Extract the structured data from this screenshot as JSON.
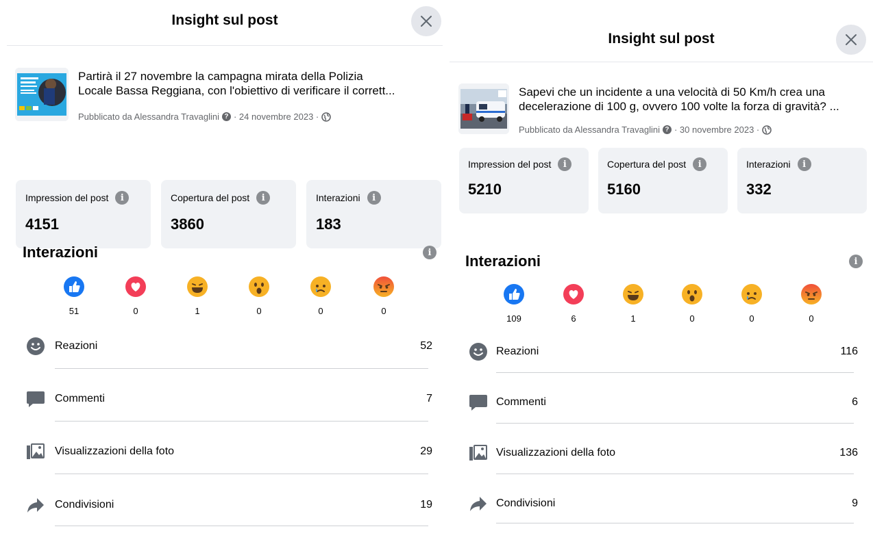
{
  "panels": [
    {
      "header_title": "Insight sul post",
      "post": {
        "text_line1": "Partirà il 27 novembre la campagna mirata della Polizia",
        "text_line2": "Locale Bassa Reggiana, con l'obiettivo di verificare il corrett...",
        "published_by": "Pubblicato da Alessandra Travaglini",
        "date": "· 24 novembre 2023 ·"
      },
      "metrics": [
        {
          "label": "Impression del post",
          "value": "4151"
        },
        {
          "label": "Copertura del post",
          "value": "3860"
        },
        {
          "label": "Interazioni",
          "value": "183"
        }
      ],
      "section_title": "Interazioni",
      "reactions": [
        {
          "icon": "like-icon",
          "count": "51"
        },
        {
          "icon": "love-icon",
          "count": "0"
        },
        {
          "icon": "haha-icon",
          "count": "1"
        },
        {
          "icon": "wow-icon",
          "count": "0"
        },
        {
          "icon": "sad-icon",
          "count": "0"
        },
        {
          "icon": "angry-icon",
          "count": "0"
        }
      ],
      "rows": [
        {
          "icon": "smiley-icon",
          "label": "Reazioni",
          "value": "52"
        },
        {
          "icon": "comment-icon",
          "label": "Commenti",
          "value": "7"
        },
        {
          "icon": "photo-icon",
          "label": "Visualizzazioni della foto",
          "value": "29"
        },
        {
          "icon": "share-icon",
          "label": "Condivisioni",
          "value": "19"
        }
      ]
    },
    {
      "header_title": "Insight sul post",
      "post": {
        "text_line1": "Sapevi che un incidente a una velocità di 50 Km/h crea una",
        "text_line2": "decelerazione di 100 g, ovvero 100 volte la forza di gravità? ...",
        "published_by": "Pubblicato da Alessandra Travaglini",
        "date": "· 30 novembre 2023 ·"
      },
      "metrics": [
        {
          "label": "Impression del post",
          "value": "5210"
        },
        {
          "label": "Copertura del post",
          "value": "5160"
        },
        {
          "label": "Interazioni",
          "value": "332"
        }
      ],
      "section_title": "Interazioni",
      "reactions": [
        {
          "icon": "like-icon",
          "count": "109"
        },
        {
          "icon": "love-icon",
          "count": "6"
        },
        {
          "icon": "haha-icon",
          "count": "1"
        },
        {
          "icon": "wow-icon",
          "count": "0"
        },
        {
          "icon": "sad-icon",
          "count": "0"
        },
        {
          "icon": "angry-icon",
          "count": "0"
        }
      ],
      "rows": [
        {
          "icon": "smiley-icon",
          "label": "Reazioni",
          "value": "116"
        },
        {
          "icon": "comment-icon",
          "label": "Commenti",
          "value": "6"
        },
        {
          "icon": "photo-icon",
          "label": "Visualizzazioni della foto",
          "value": "136"
        },
        {
          "icon": "share-icon",
          "label": "Condivisioni",
          "value": "9"
        }
      ]
    }
  ],
  "colors": {
    "like": "#1877f2",
    "love": "#f33e58",
    "emoji_yellow": "#f7b125",
    "angry": "#e9710f",
    "card_bg": "#f0f2f5",
    "secondary_text": "#65676b"
  }
}
